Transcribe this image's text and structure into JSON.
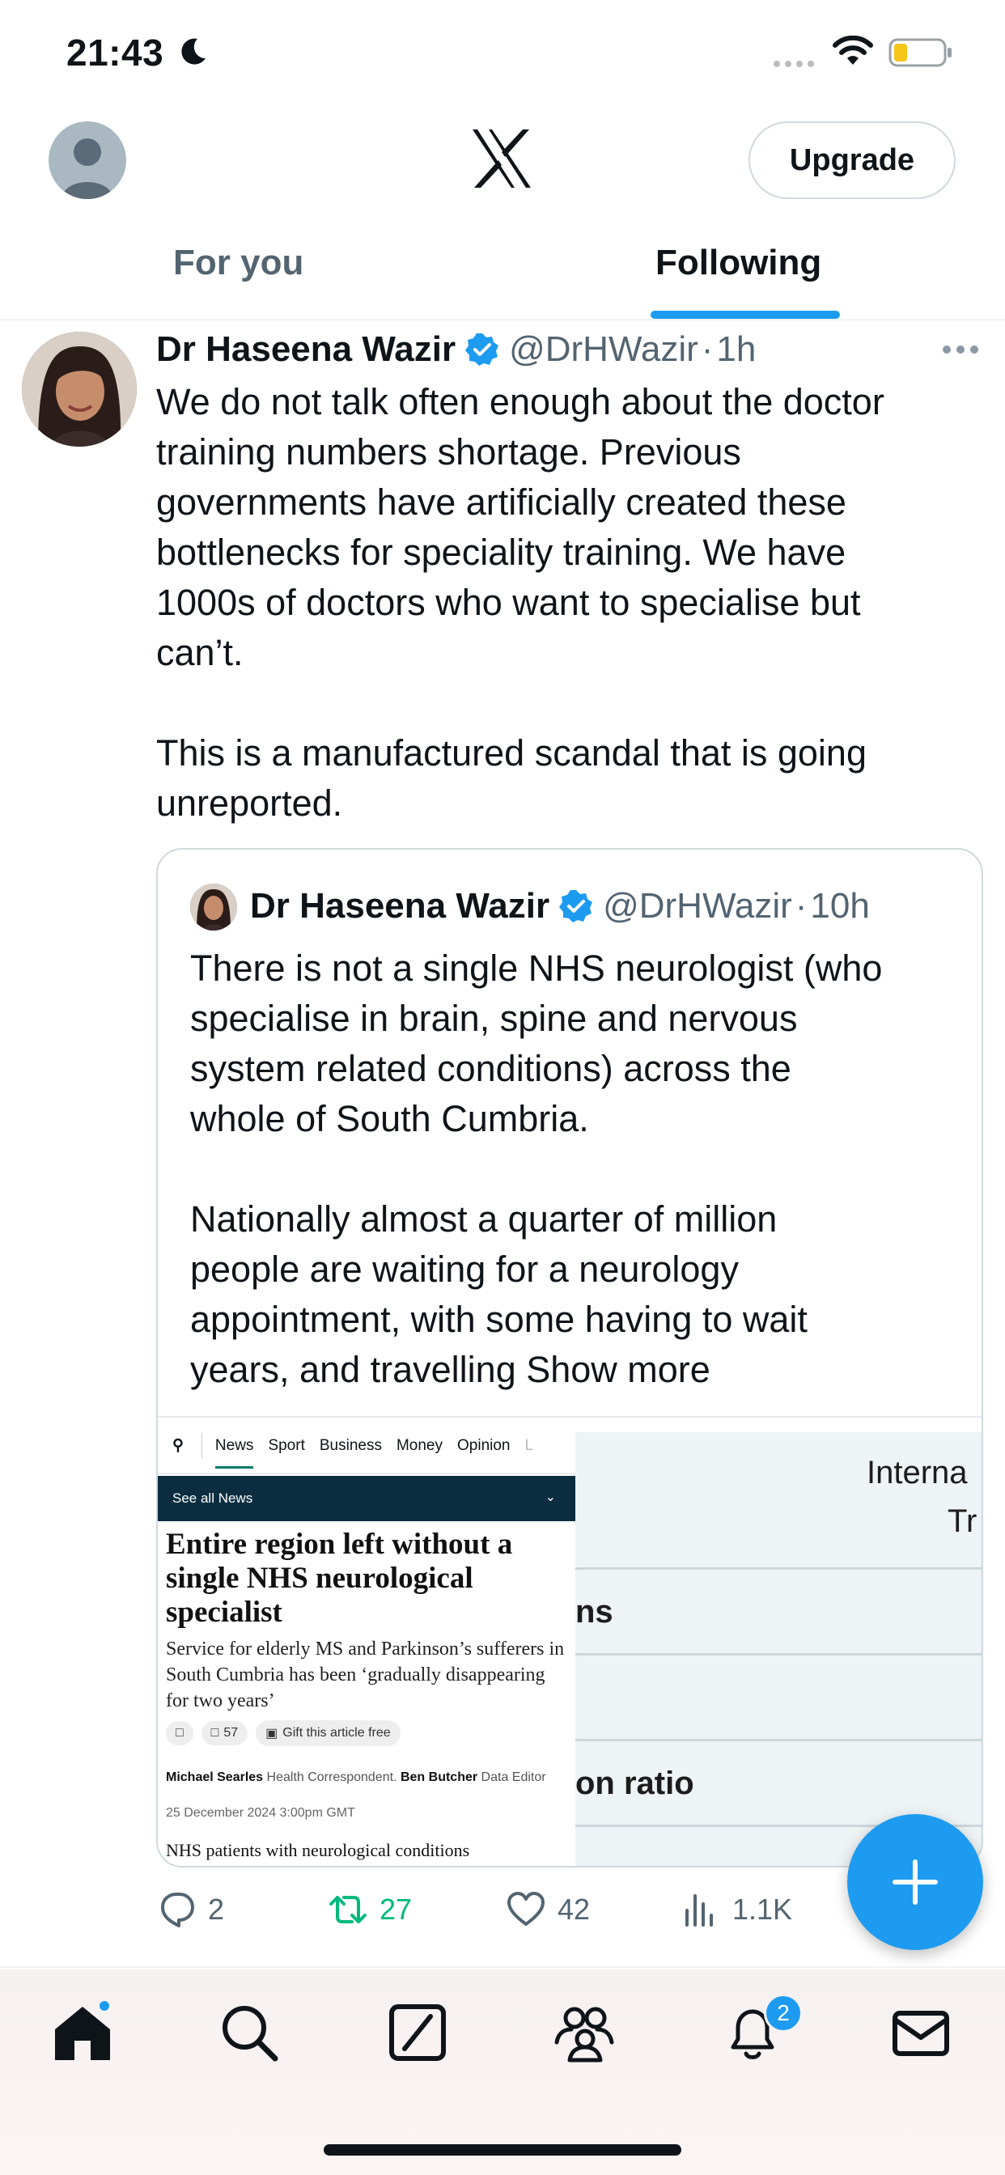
{
  "status_bar": {
    "time": "21:43"
  },
  "header": {
    "upgrade_label": "Upgrade"
  },
  "tabs": [
    {
      "label": "For you",
      "active": false
    },
    {
      "label": "Following",
      "active": true
    }
  ],
  "tweet": {
    "author_name": "Dr Haseena Wazir",
    "handle": "@DrHWazir",
    "separator": "·",
    "time": "1h",
    "text_lines": [
      "We do not talk often enough about the doctor",
      "training numbers shortage. Previous",
      "governments have artificially created these",
      "bottlenecks for speciality training. We have",
      "1000s of doctors who want to specialise but",
      "can’t."
    ],
    "text_lines_2": [
      "This is a manufactured scandal that is going",
      "unreported."
    ],
    "quote": {
      "author_name": "Dr Haseena Wazir",
      "handle": "@DrHWazir",
      "separator": "·",
      "time": "10h",
      "text_lines": [
        "There is not a single NHS neurologist (who",
        "specialise in brain, spine and nervous",
        "system related conditions) across the",
        "whole of South Cumbria."
      ],
      "text_lines_2": [
        "Nationally almost a quarter of million",
        "people are waiting for a neurology",
        "appointment, with some having to wait"
      ],
      "last_line": "years, and travelling ",
      "show_more": "Show more",
      "media_left": {
        "nav": [
          "News",
          "Sport",
          "Business",
          "Money",
          "Opinion",
          "L"
        ],
        "bar_label": "See all News",
        "headline": "Entire region left without a single NHS neurological specialist",
        "standfirst": "Service for elderly MS and Parkinson’s sufferers in South Cumbria has been ‘gradually disappearing for two years’",
        "comments": "57",
        "gift_label": "Gift this article free",
        "author1": "Michael Searles",
        "role1": "Health Correspondent.",
        "author2": "Ben Butcher",
        "role2": "Data Editor",
        "date": "25 December 2024 3:00pm GMT",
        "body_start": "NHS patients with neurological conditions"
      },
      "media_right": {
        "header_1": "Interna",
        "header_2": "Tr",
        "rows": [
          "ns",
          "",
          "on ratio"
        ]
      }
    },
    "actions": {
      "replies": "2",
      "retweets": "27",
      "likes": "42",
      "views": "1.1K"
    }
  },
  "bottom_nav": {
    "notification_count": "2"
  },
  "colors": {
    "accent": "#1d9bf0",
    "retweet": "#00ba7c",
    "text": "#0f1419",
    "muted": "#536471"
  }
}
